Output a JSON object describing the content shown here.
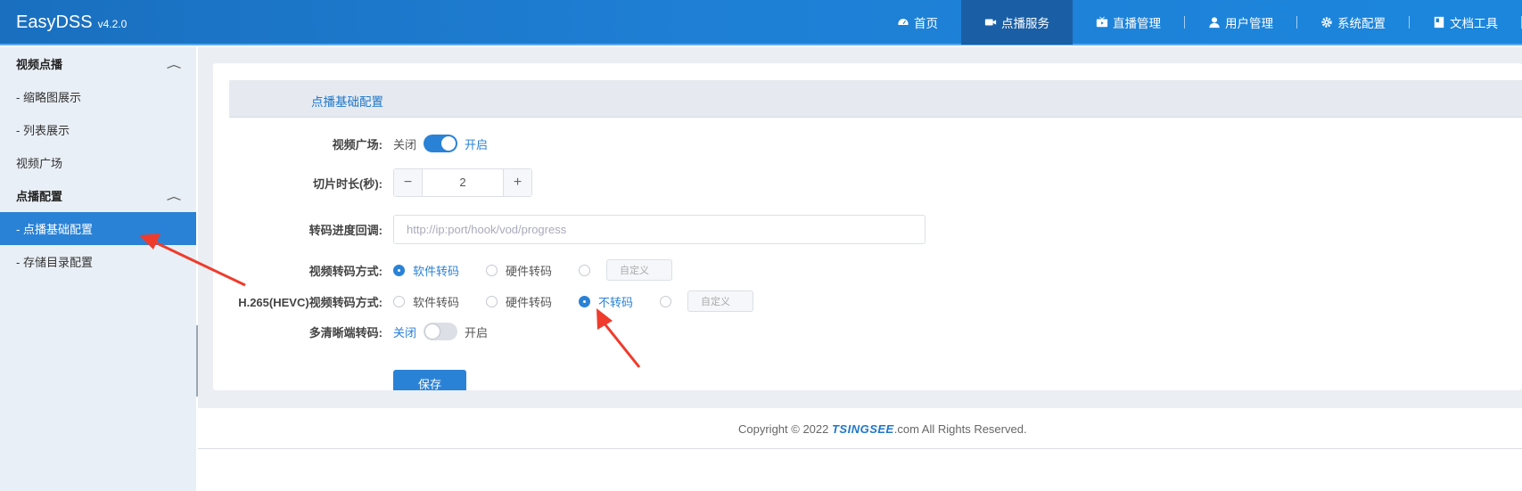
{
  "header": {
    "brand": "EasyDSS",
    "version": "v4.2.0",
    "nav": [
      {
        "label": "首页",
        "icon": "dashboard-icon"
      },
      {
        "label": "点播服务",
        "icon": "video-camera-icon"
      },
      {
        "label": "直播管理",
        "icon": "live-icon"
      },
      {
        "label": "用户管理",
        "icon": "user-icon"
      },
      {
        "label": "系统配置",
        "icon": "gear-icon"
      },
      {
        "label": "文档工具",
        "icon": "document-icon"
      }
    ],
    "active_nav": "点播服务"
  },
  "sidebar": {
    "group1": "视频点播",
    "items1": [
      "- 缩略图展示",
      "- 列表展示",
      "视频广场"
    ],
    "group2": "点播配置",
    "items2": [
      "- 点播基础配置",
      "- 存储目录配置"
    ],
    "active_item": "- 点播基础配置"
  },
  "form": {
    "title": "点播基础配置",
    "square_label": "视频广场:",
    "off": "关闭",
    "on": "开启",
    "square_enabled": true,
    "slice_label": "切片时长(秒):",
    "slice_minus": "−",
    "slice_value": "2",
    "slice_plus": "+",
    "callback_label": "转码进度回调:",
    "callback_placeholder": "http://ip:port/hook/vod/progress",
    "video_transcode_label": "视频转码方式:",
    "software": "软件转码",
    "hardware": "硬件转码",
    "no_transcode": "不转码",
    "custom": "自定义",
    "video_transcode_selected": "软件转码",
    "h265_label": "H.265(HEVC)视频转码方式:",
    "h265_selected": "不转码",
    "multi_label": "多清晰端转码:",
    "multi_enabled": false,
    "save": "保存"
  },
  "footer": {
    "copy_prefix": "Copyright © 2022 ",
    "logo": "TSINGSEE",
    "copy_suffix": ".com All Rights Reserved."
  },
  "colors": {
    "accent": "#2a82d6",
    "header": "#1e7fd4",
    "arrow": "#ef3b2c"
  }
}
